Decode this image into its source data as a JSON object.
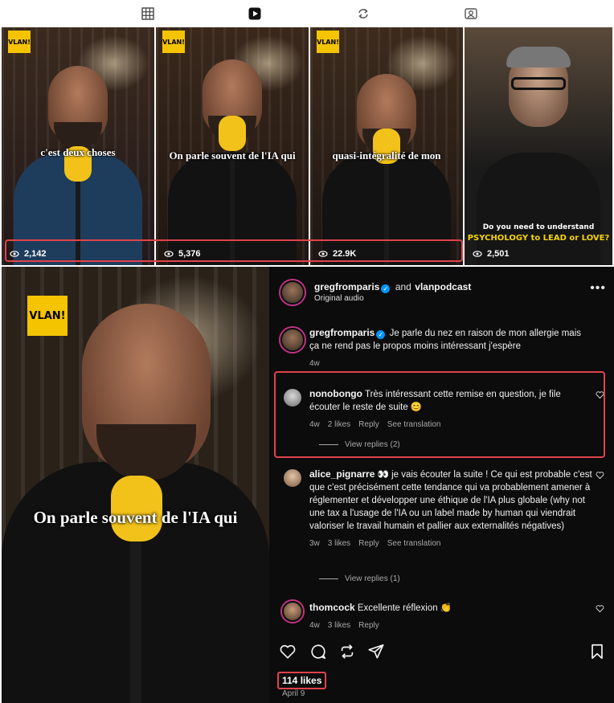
{
  "tabs": [
    {
      "icon": "grid-icon"
    },
    {
      "icon": "reels-icon"
    },
    {
      "icon": "remix-icon"
    },
    {
      "icon": "tagged-icon"
    }
  ],
  "reels": [
    {
      "caption": "c'est deux choses",
      "views": "2,142",
      "logo": "VLAN!"
    },
    {
      "caption": "On parle souvent de l'IA qui",
      "views": "5,376",
      "logo": "VLAN!"
    },
    {
      "caption": "quasi-intégralité de mon",
      "views": "22.9K",
      "logo": "VLAN!"
    },
    {
      "caption": "",
      "views": "2,501",
      "promo_line1": "Do you need to understand",
      "promo_line2": "PSYCHOLOGY to LEAD or LOVE?"
    }
  ],
  "post": {
    "media_caption": "On parle souvent de l'IA qui",
    "logo": "VLAN!",
    "author": "gregfromparis",
    "collab_joiner": "and",
    "collaborator": "vlanpodcast",
    "audio": "Original audio",
    "caption_author": "gregfromparis",
    "caption_text": "Je parle du nez en raison de mon allergie mais ça ne rend pas le propos moins intéressant j'espère",
    "caption_age": "4w",
    "comments": [
      {
        "user": "nonobongo",
        "text": "Très intéressant cette remise en question, je file écouter le reste de suite 😊",
        "age": "4w",
        "likes": "2 likes",
        "reply": "Reply",
        "translate": "See translation",
        "view_replies": "View replies (2)"
      },
      {
        "user": "alice_pignarre",
        "text": "👀 je vais écouter la suite ! Ce qui est probable c'est que c'est précisément cette tendance qui va probablement amener à réglementer et développer une éthique de l'IA plus globale (why not une tax a l'usage de l'IA ou un label made by human qui viendrait valoriser le travail humain et pallier aux externalités négatives)",
        "age": "3w",
        "likes": "3 likes",
        "reply": "Reply",
        "translate": "See translation",
        "view_replies": "View replies (1)"
      },
      {
        "user": "thomcock",
        "text": "Excellente réflexion 👏",
        "age": "4w",
        "likes": "3 likes",
        "reply": "Reply"
      }
    ],
    "likes": "114 likes",
    "date": "April 9"
  },
  "colors": {
    "highlight": "#e0434c",
    "verified": "#0095f6",
    "dark_bg": "#0c0c0d"
  }
}
